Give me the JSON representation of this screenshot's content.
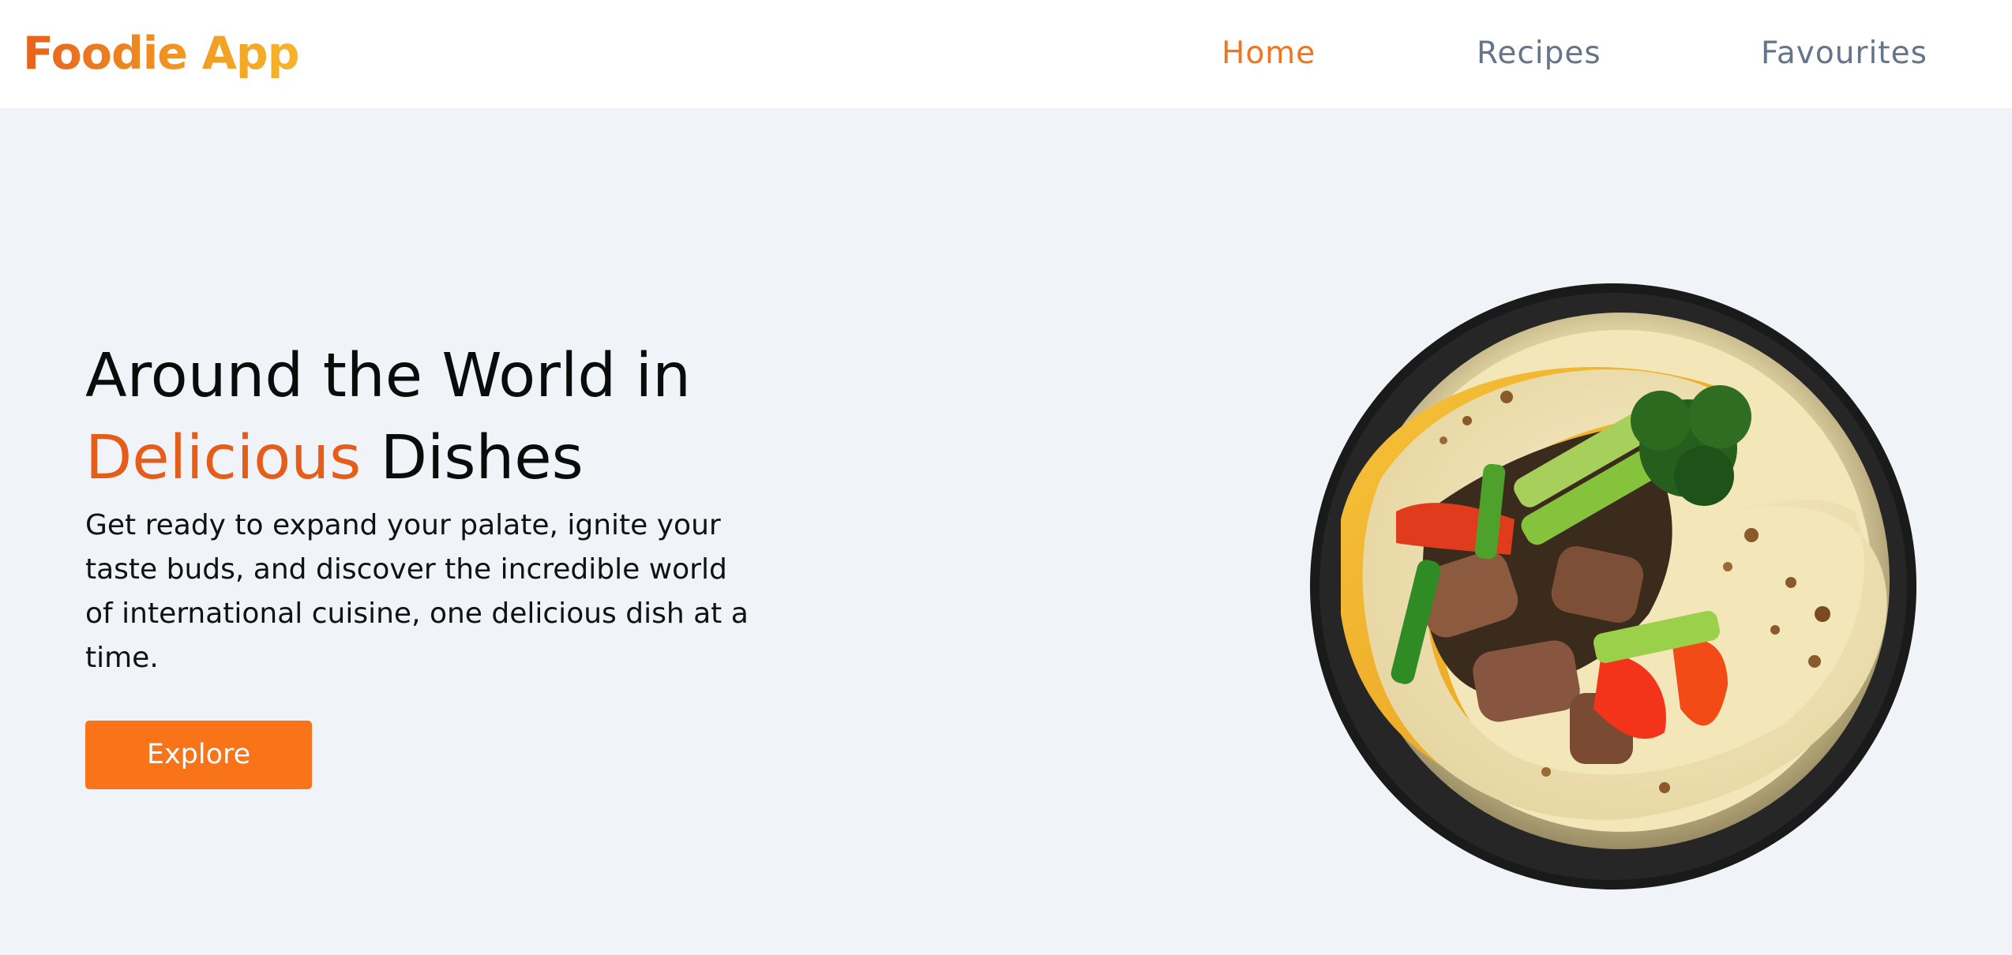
{
  "header": {
    "logo": "Foodie App",
    "nav": [
      {
        "label": "Home",
        "active": true
      },
      {
        "label": "Recipes",
        "active": false
      },
      {
        "label": "Favourites",
        "active": false
      }
    ]
  },
  "hero": {
    "title_line1": "Around the World in",
    "title_accent": "Delicious",
    "title_rest": "Dishes",
    "description": "Get ready to expand your palate, ignite your taste buds, and discover the incredible world of international cuisine, one delicious dish at a time.",
    "button_label": "Explore",
    "image_subject": "wrap-in-bowl"
  },
  "colors": {
    "accent": "#f97318",
    "accent_text": "#e65d1a",
    "nav_inactive": "#64748b",
    "background": "#f0f3f8"
  }
}
